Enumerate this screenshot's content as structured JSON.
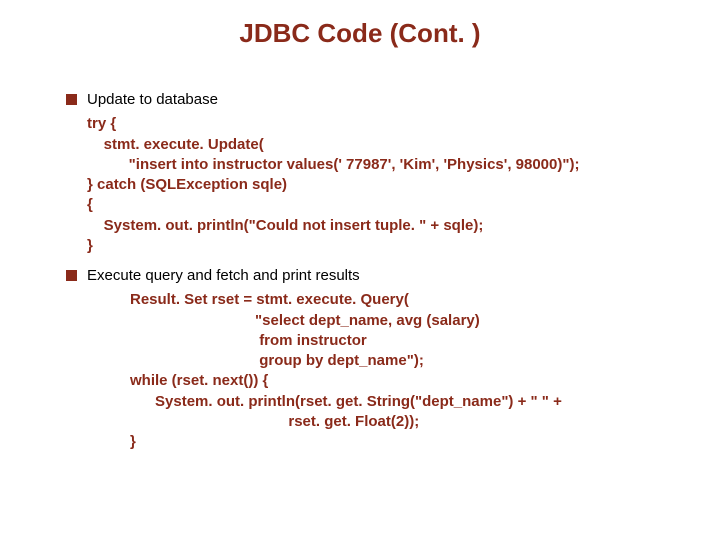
{
  "title": "JDBC Code (Cont. )",
  "bullets": [
    {
      "text": "Update to database",
      "code": "try {\n    stmt. execute. Update(\n          \"insert into instructor values(' 77987', 'Kim', 'Physics', 98000)\");\n} catch (SQLException sqle)\n{\n    System. out. println(\"Could not insert tuple. \" + sqle);\n}"
    },
    {
      "text": "Execute query and fetch and print results",
      "code": "Result. Set rset = stmt. execute. Query(\n                              \"select dept_name, avg (salary)\n                               from instructor\n                               group by dept_name\");\nwhile (rset. next()) {\n      System. out. println(rset. get. String(\"dept_name\") + \" \" +\n                                      rset. get. Float(2));\n}"
    }
  ]
}
